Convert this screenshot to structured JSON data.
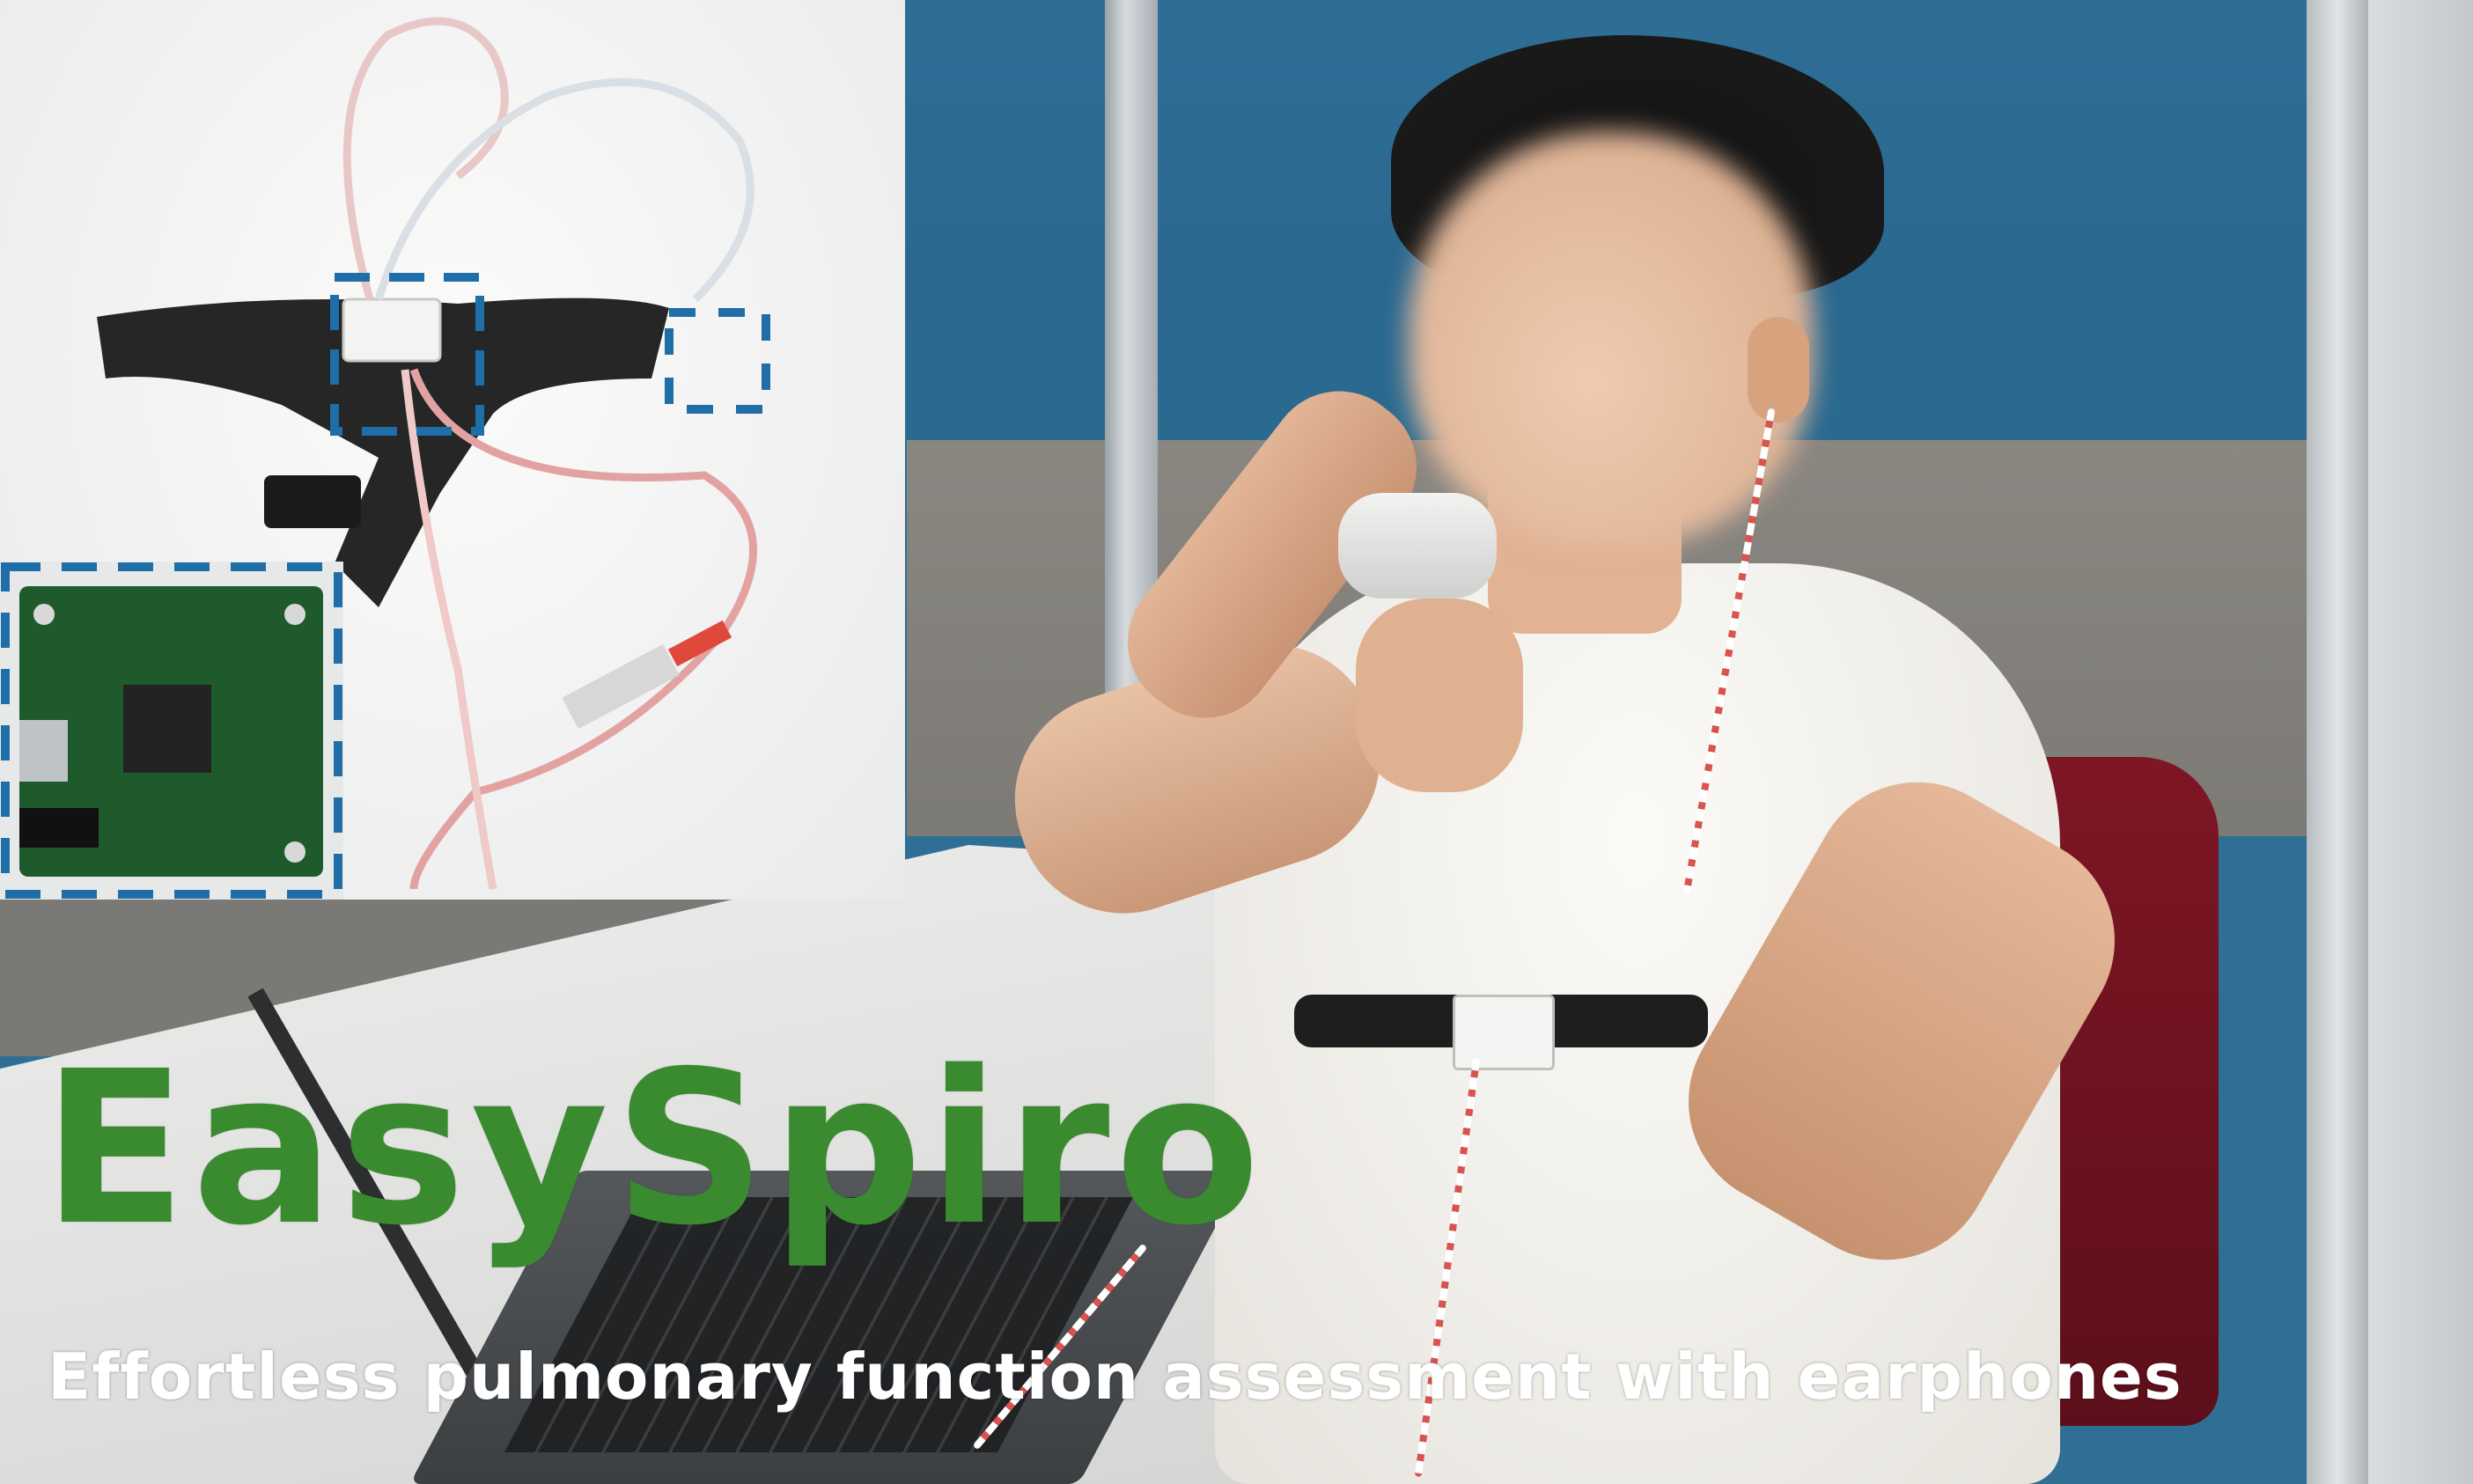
{
  "title": "EasySpiro",
  "subtitle": "Effortless pulmonary function assessment with earphones",
  "colors": {
    "title": "#3a8a2f",
    "subtitle": "#ffffff",
    "highlight_frame": "#1f6ea8"
  }
}
